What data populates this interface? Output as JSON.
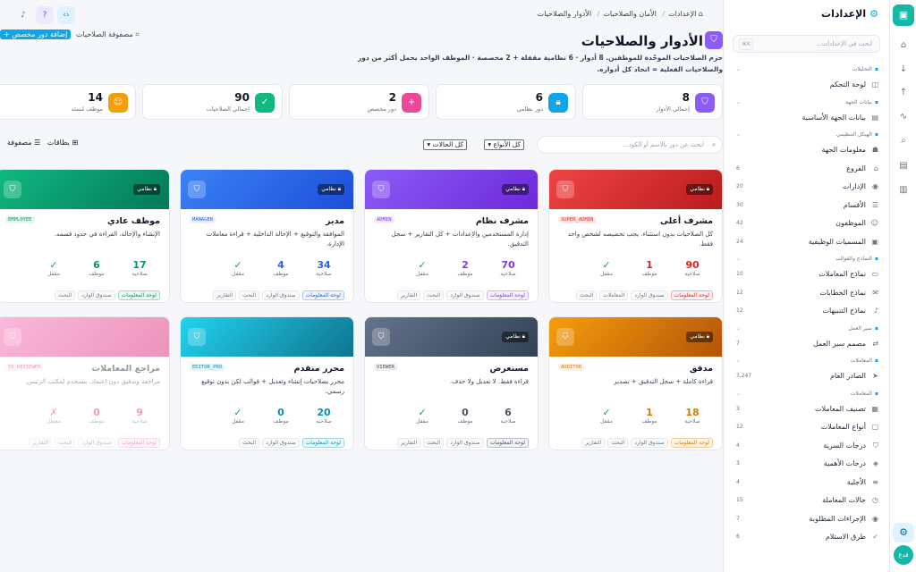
{
  "breadcrumb": {
    "home": "الإعدادات",
    "security": "الأمان والصلاحيات",
    "current": "الأدوار والصلاحيات"
  },
  "page": {
    "title": "الأدوار والصلاحيات",
    "description": "حزم الصلاحيات الموحّدة للموظفين. 8 أدوار · 6 نظامية مقفلة + 2 مخصصة · الموظف الواحد يحمل أكثر من دور والصلاحيات الفعلية = اتحاد كل أدواره.",
    "matrix_label": "مصفوفة الصلاحيات",
    "add_role": "إضافة دور مخصص"
  },
  "stats": [
    {
      "value": "8",
      "label": "إجمالي الأدوار",
      "color": "#8b5cf6",
      "icon": "shield-icon"
    },
    {
      "value": "6",
      "label": "دور نظامي",
      "color": "#0ea5e9",
      "icon": "lock-icon"
    },
    {
      "value": "2",
      "label": "دور مخصص",
      "color": "#ec4899",
      "icon": "plus-icon"
    },
    {
      "value": "90",
      "label": "إجمالي الصلاحيات",
      "color": "#10b981",
      "icon": "check-icon"
    },
    {
      "value": "14",
      "label": "موظف مُسنَد",
      "color": "#f59e0b",
      "icon": "user-icon"
    }
  ],
  "filters": {
    "search_placeholder": "ابحث عن دور بالاسم أو الكود...",
    "type_value": "كل الأنواع",
    "status_value": "كل الحالات",
    "view_cards": "بطاقات",
    "view_matrix": "مصفوفة"
  },
  "labels": {
    "system": "نظامي",
    "permissions": "صلاحية",
    "employees": "موظف",
    "locked": "مقفل",
    "disabled": "معطل"
  },
  "roles": [
    {
      "name": "مشرف أعلى",
      "code": "SUPER_ADMIN",
      "system": true,
      "desc": "كل الصلاحيات بدون استثناء. يجب تخصيصه لشخص واحد فقط.",
      "perms": "90",
      "emps": "1",
      "locked": "✓",
      "color": "#dc2626",
      "grad": "linear-gradient(135deg,#ef4444,#b91c1c)",
      "tags": [
        "لوحة المعلومات",
        "صندوق الوارد",
        "المعاملات",
        "البحث"
      ],
      "faded": false
    },
    {
      "name": "مشرف نظام",
      "code": "ADMIN",
      "system": true,
      "desc": "إدارة المستخدمين والإعدادات + كل التقارير + سجل التدقيق.",
      "perms": "70",
      "emps": "2",
      "locked": "✓",
      "color": "#7c3aed",
      "grad": "linear-gradient(135deg,#8b5cf6,#6d28d9)",
      "tags": [
        "لوحة المعلومات",
        "صندوق الوارد",
        "البحث",
        "التقارير"
      ],
      "faded": true
    },
    {
      "name": "مدير",
      "code": "MANAGER",
      "system": true,
      "desc": "الموافقة والتوقيع + الإحالة الداخلية + قراءة معاملات الإدارة.",
      "perms": "34",
      "emps": "4",
      "locked": "✓",
      "color": "#2563eb",
      "grad": "linear-gradient(135deg,#3b82f6,#1d4ed8)",
      "tags": [
        "لوحة المعلومات",
        "صندوق الوارد",
        "البحث",
        "التقارير"
      ],
      "faded": false
    },
    {
      "name": "موظف عادي",
      "code": "EMPLOYEE",
      "system": true,
      "desc": "الإنشاء والإحالة. القراءة في حدود قسمه.",
      "perms": "17",
      "emps": "6",
      "locked": "✓",
      "color": "#059669",
      "grad": "linear-gradient(135deg,#10b981,#047857)",
      "tags": [
        "لوحة المعلومات",
        "صندوق الوارد",
        "البحث"
      ],
      "faded": false
    },
    {
      "name": "مدقق",
      "code": "AUDITOR",
      "system": true,
      "desc": "قراءة كاملة + سجل التدقيق + تصدير",
      "perms": "18",
      "emps": "1",
      "locked": "✓",
      "color": "#d97706",
      "grad": "linear-gradient(135deg,#f59e0b,#b45309)",
      "tags": [
        "لوحة المعلومات",
        "صندوق الوارد",
        "البحث",
        "التقارير"
      ],
      "faded": false
    },
    {
      "name": "مستعرض",
      "code": "VIEWER",
      "system": true,
      "desc": "قراءة فقط. لا تعديل ولا حذف.",
      "perms": "6",
      "emps": "0",
      "locked": "✓",
      "color": "#475569",
      "grad": "linear-gradient(135deg,#64748b,#334155)",
      "tags": [
        "لوحة المعلومات",
        "صندوق الوارد",
        "البحث",
        "التقارير"
      ],
      "faded": true
    },
    {
      "name": "محرر متقدم",
      "code": "EDITOR_PRO",
      "system": false,
      "desc": "محرر بصلاحيات إنشاء وتعديل + قوالب لكن بدون توقيع رسمي.",
      "perms": "20",
      "emps": "0",
      "locked": "✓",
      "color": "#0891b2",
      "grad": "linear-gradient(135deg,#22d3ee,#0e7490)",
      "tags": [
        "لوحة المعلومات",
        "صندوق الوارد",
        "البحث"
      ],
      "faded": false
    },
    {
      "name": "مراجع المعاملات",
      "code": "TX_REVIEWER",
      "system": false,
      "desc": "مراجعة وتدقيق دون اعتماد. يستخدم لمكتب الرئيس.",
      "perms": "9",
      "emps": "0",
      "locked": "✗",
      "color": "#db2777",
      "grad": "linear-gradient(135deg,#f472b6,#db2777)",
      "tags": [
        "لوحة المعلومات",
        "صندوق الوارد",
        "البحث",
        "التقارير"
      ],
      "faded": true,
      "status_disabled": true
    }
  ],
  "sidebar": {
    "title": "الإعدادات",
    "search_placeholder": "ابحث في الإعدادات...",
    "kbd": "K⌘",
    "sections": [
      {
        "label": "التحليلات",
        "items": [
          {
            "label": "لوحة التحكم",
            "count": ""
          }
        ]
      },
      {
        "label": "بيانات الجهة",
        "items": [
          {
            "label": "بيانات الجهة الأساسية",
            "count": ""
          }
        ]
      },
      {
        "label": "الهيكل التنظيمي",
        "items": [
          {
            "label": "معلومات الجهة",
            "count": ""
          },
          {
            "label": "الفروع",
            "count": "6"
          },
          {
            "label": "الإدارات",
            "count": "20"
          },
          {
            "label": "الأقسام",
            "count": "30"
          },
          {
            "label": "الموظفون",
            "count": "42"
          },
          {
            "label": "المسميات الوظيفية",
            "count": "24"
          }
        ]
      },
      {
        "label": "النماذج والقوالب",
        "items": [
          {
            "label": "نماذج المعاملات",
            "count": "10"
          },
          {
            "label": "نماذج الخطابات",
            "count": "12"
          },
          {
            "label": "نماذج التنبيهات",
            "count": "12"
          }
        ]
      },
      {
        "label": "سير العمل",
        "items": [
          {
            "label": "مصمم سير العمل",
            "count": "7"
          }
        ]
      },
      {
        "label": "المعاملات",
        "items": [
          {
            "label": "الصادر العام",
            "count": "3,247"
          }
        ]
      },
      {
        "label": "المعاملات",
        "items": [
          {
            "label": "تصنيف المعاملات",
            "count": "3"
          },
          {
            "label": "أنواع المعاملات",
            "count": "12"
          },
          {
            "label": "درجات السرية",
            "count": "4"
          },
          {
            "label": "درجات الأهمية",
            "count": "3"
          },
          {
            "label": "الأجلية",
            "count": "4"
          },
          {
            "label": "حالات المعاملة",
            "count": "15"
          },
          {
            "label": "الإجراءات المطلوبة",
            "count": "7"
          },
          {
            "label": "طرق الاستلام",
            "count": "6"
          }
        ]
      }
    ]
  },
  "rail": {
    "avatar": "فدع"
  }
}
